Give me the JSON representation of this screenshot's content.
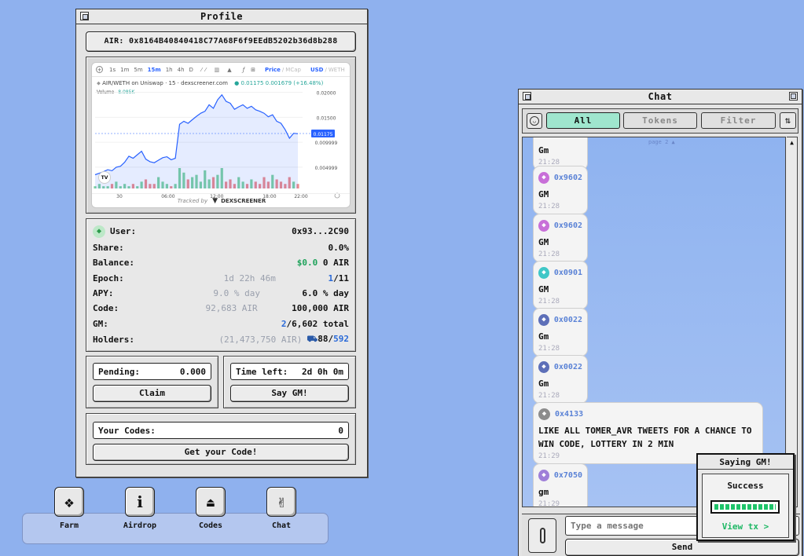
{
  "profile": {
    "title": "Profile",
    "air_address": "AIR: 0x8164B40840418C77A68F6f9EEdB5202b36d8b288",
    "chart": {
      "toolbar": {
        "intervals": [
          "1s",
          "1m",
          "5m",
          "15m",
          "1h",
          "4h",
          "D"
        ],
        "price_label": "Price",
        "mcap_label": "MCap",
        "usd_label": "USD",
        "weth_label": "WETH"
      },
      "pair_label": "AIR/WETH on Uniswap · 15 · dexscreener.com",
      "ohlc": "0.01175  0.001679 (+16.48%)",
      "volume_label": "Volume",
      "volume_value": "8.085K",
      "price_tag": "0.01175",
      "footer_tracked": "Tracked by",
      "footer_brand": "DEXSCREENER",
      "tv_logo": "TV"
    },
    "stats": {
      "user_label": "User:",
      "user_value": "0x93...2C90",
      "share_label": "Share:",
      "share_value": "0.0%",
      "balance_label": "Balance:",
      "balance_usd": "$0.0",
      "balance_air": "0 AIR",
      "epoch_label": "Epoch:",
      "epoch_mid": "1d 22h 46m",
      "epoch_current": "1",
      "epoch_total": "/11",
      "apy_label": "APY:",
      "apy_mid": "9.0 % day",
      "apy_value": "6.0 % day",
      "code_label": "Code:",
      "code_mid": "92,683 AIR",
      "code_value": "100,000 AIR",
      "gm_label": "GM:",
      "gm_current": "2",
      "gm_total": "/6,602 total",
      "holders_label": "Holders:",
      "holders_mid": "(21,473,750 AIR)",
      "holders_count": "88",
      "holders_total": "592"
    },
    "pending_label": "Pending:",
    "pending_value": "0.000",
    "claim_label": "Claim",
    "time_left_label": "Time left:",
    "time_left_value": "2d 0h 0m",
    "say_gm_label": "Say GM!",
    "your_codes_label": "Your Codes:",
    "your_codes_value": "0",
    "get_code_label": "Get your Code!"
  },
  "chart_data": {
    "type": "line",
    "title": "AIR/WETH on Uniswap · 15 · dexscreener.com",
    "x_ticks": [
      "30",
      "06:00",
      "12:00",
      "18:00",
      "22:00"
    ],
    "y_ticks": [
      "0.02000",
      "0.01500",
      "0.009999",
      "0.004999"
    ],
    "ylim": [
      0.002,
      0.0215
    ],
    "series": [
      {
        "values": [
          0.0035,
          0.0038,
          0.0041,
          0.0045,
          0.0043,
          0.005,
          0.0052,
          0.006,
          0.0072,
          0.0068,
          0.0075,
          0.0082,
          0.0066,
          0.0061,
          0.0059,
          0.0064,
          0.0069,
          0.0071,
          0.0065,
          0.0068,
          0.0136,
          0.0142,
          0.0138,
          0.0145,
          0.0152,
          0.0158,
          0.0162,
          0.0175,
          0.0168,
          0.0185,
          0.0195,
          0.0182,
          0.0178,
          0.0166,
          0.0171,
          0.0175,
          0.0168,
          0.0172,
          0.0165,
          0.0162,
          0.0158,
          0.0151,
          0.0155,
          0.0142,
          0.0138,
          0.0125,
          0.0108,
          0.0118,
          0.0117
        ]
      }
    ],
    "volume": [
      1,
      2,
      1,
      1,
      2,
      3,
      1,
      2,
      1,
      2,
      1,
      3,
      4,
      2,
      2,
      5,
      3,
      2,
      1,
      2,
      9,
      7,
      4,
      5,
      6,
      3,
      8,
      4,
      5,
      6,
      9,
      3,
      4,
      2,
      5,
      3,
      2,
      4,
      3,
      2,
      5,
      3,
      6,
      4,
      3,
      2,
      5,
      3,
      2
    ],
    "current_price": 0.01175
  },
  "dock": {
    "items": [
      {
        "label": "Farm",
        "icon": "farm-icon"
      },
      {
        "label": "Airdrop",
        "icon": "info-icon"
      },
      {
        "label": "Codes",
        "icon": "eject-icon"
      },
      {
        "label": "Chat",
        "icon": "peace-hand-icon"
      }
    ]
  },
  "chat": {
    "title": "Chat",
    "tabs": [
      "All",
      "Tokens",
      "Filter"
    ],
    "page_indicator": "page 2 ▲",
    "messages": [
      {
        "addr": "",
        "text": "Gm",
        "time": "21:28",
        "color": "#b98cdc"
      },
      {
        "addr": "0x9602",
        "text": "GM",
        "time": "21:28",
        "color": "#c86fd8"
      },
      {
        "addr": "0x9602",
        "text": "GM",
        "time": "21:28",
        "color": "#c86fd8"
      },
      {
        "addr": "0x0901",
        "text": "GM",
        "time": "21:28",
        "color": "#3fc7c7"
      },
      {
        "addr": "0x0022",
        "text": "Gm",
        "time": "21:28",
        "color": "#5d6fb8"
      },
      {
        "addr": "0x0022",
        "text": "Gm",
        "time": "21:28",
        "color": "#5d6fb8"
      },
      {
        "addr": "0x4133",
        "text": "LIKE ALL TOMER_AVR TWEETS FOR A CHANCE TO WIN CODE, LOTTERY IN 2 MIN",
        "time": "21:29",
        "color": "#8c8c8c"
      },
      {
        "addr": "0x7050",
        "text": "gm",
        "time": "21:29",
        "color": "#9f7fd8"
      }
    ],
    "input_placeholder": "Type a message",
    "send_label": "Send"
  },
  "toast": {
    "title": "Saying GM!",
    "status": "Success",
    "progress": 1.0,
    "link": "View tx >"
  }
}
